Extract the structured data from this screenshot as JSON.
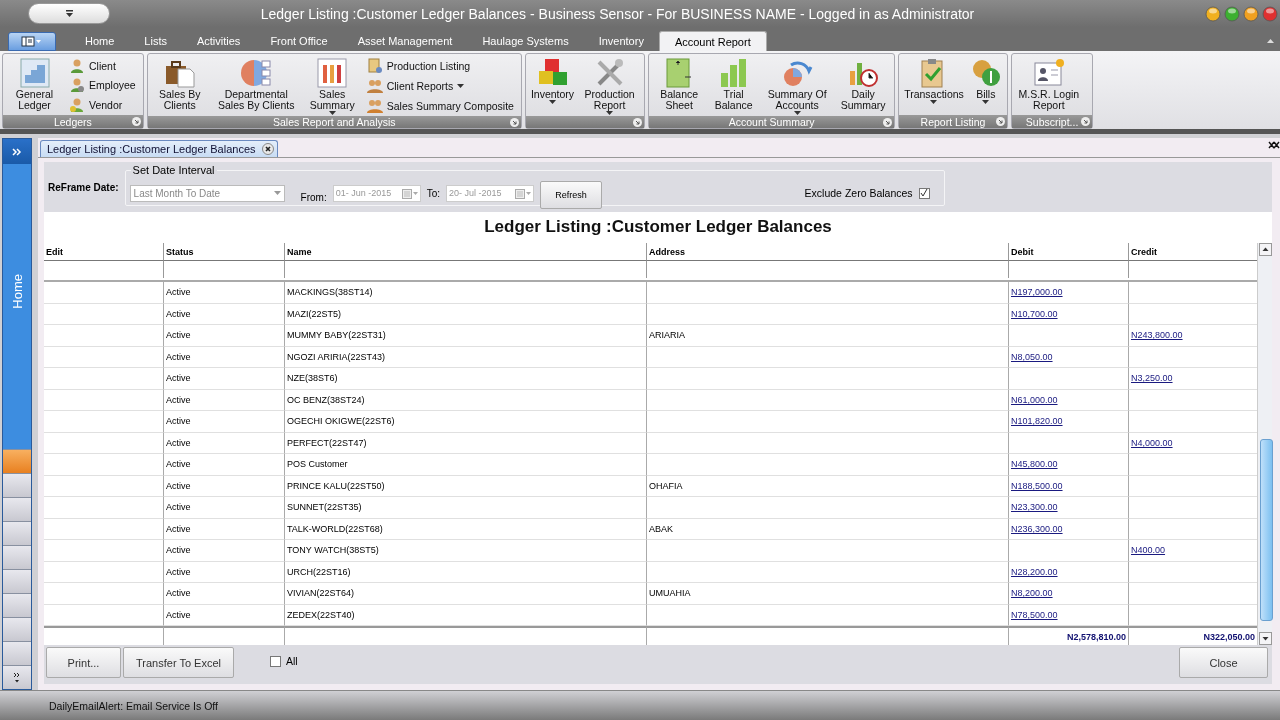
{
  "window": {
    "title": "Ledger Listing :Customer Ledger Balances - Business Sensor - For BUSINESS NAME - Logged in as Administrator"
  },
  "ribbon_tabs": [
    {
      "label": "Home",
      "selected": false
    },
    {
      "label": "Lists",
      "selected": false
    },
    {
      "label": "Activities",
      "selected": false
    },
    {
      "label": "Front Office",
      "selected": false
    },
    {
      "label": "Asset Management",
      "selected": false
    },
    {
      "label": "Haulage Systems",
      "selected": false
    },
    {
      "label": "Inventory",
      "selected": false
    },
    {
      "label": "Account Report",
      "selected": true
    }
  ],
  "ribbon_groups": [
    {
      "label": "Ledgers",
      "items": [
        {
          "kind": "large",
          "label": "General Ledger",
          "dropdown": false
        },
        {
          "kind": "small",
          "label": "Client",
          "dropdown": false
        },
        {
          "kind": "small",
          "label": "Employee",
          "dropdown": false
        },
        {
          "kind": "small",
          "label": "Vendor",
          "dropdown": false
        }
      ]
    },
    {
      "label": "Sales Report and Analysis",
      "items": [
        {
          "kind": "large",
          "label": "Sales By Clients",
          "dropdown": false
        },
        {
          "kind": "large",
          "label": "Departmental Sales By Clients",
          "dropdown": false
        },
        {
          "kind": "large",
          "label": "Sales Summary",
          "dropdown": true
        },
        {
          "kind": "small",
          "label": "Production Listing",
          "dropdown": false
        },
        {
          "kind": "small",
          "label": "Client Reports",
          "dropdown": true
        },
        {
          "kind": "small",
          "label": "Sales Summary Composite",
          "dropdown": false
        }
      ]
    },
    {
      "items": [
        {
          "kind": "large",
          "label": "Inventory",
          "dropdown": true
        },
        {
          "kind": "large",
          "label": "Production Report",
          "dropdown": true
        }
      ]
    },
    {
      "label": "Account Summary",
      "items": [
        {
          "kind": "large",
          "label": "Balance Sheet",
          "dropdown": false
        },
        {
          "kind": "large",
          "label": "Trial Balance",
          "dropdown": false
        },
        {
          "kind": "large",
          "label": "Summary Of Accounts",
          "dropdown": true
        },
        {
          "kind": "large",
          "label": "Daily Summary",
          "dropdown": false
        }
      ]
    },
    {
      "label": "Report Listing",
      "items": [
        {
          "kind": "large",
          "label": "Transactions",
          "dropdown": true
        },
        {
          "kind": "large",
          "label": "Bills",
          "dropdown": true
        }
      ]
    },
    {
      "label": "Subscript...",
      "items": [
        {
          "kind": "large",
          "label": "M.S.R. Login Report",
          "dropdown": false
        }
      ]
    }
  ],
  "nav": {
    "label": "Home",
    "buttons": [
      {
        "selected": true
      },
      {
        "selected": false
      },
      {
        "selected": false
      },
      {
        "selected": false
      },
      {
        "selected": false
      },
      {
        "selected": false
      },
      {
        "selected": false
      },
      {
        "selected": false
      },
      {
        "selected": false
      }
    ]
  },
  "document_tab": {
    "label": "Ledger Listing :Customer Ledger Balances"
  },
  "filter": {
    "reframe_label": "ReFrame Date:",
    "group_title": "Set Date Interval",
    "period": "Last Month To Date",
    "from_label": "From:",
    "from": "01- Jun -2015",
    "to_label": "To:",
    "to": "20- Jul -2015",
    "refresh": "Refresh",
    "exclude_zero_label": "Exclude Zero Balances",
    "exclude_zero_checked": true
  },
  "report_title": "Ledger Listing :Customer Ledger Balances",
  "table": {
    "columns": [
      "Edit",
      "Status",
      "Name",
      "Address",
      "Debit",
      "Credit"
    ],
    "rows": [
      {
        "status": "Active",
        "name": "MACKINGS(38ST14)",
        "debit": "N197,000.00"
      },
      {
        "status": "Active",
        "name": "MAZI(22ST5)",
        "debit": "N10,700.00"
      },
      {
        "status": "Active",
        "name": "MUMMY BABY(22ST31)",
        "address": "ARIARIA",
        "credit": "N243,800.00"
      },
      {
        "status": "Active",
        "name": "NGOZI ARIRIA(22ST43)",
        "debit": "N8,050.00"
      },
      {
        "status": "Active",
        "name": "NZE(38ST6)",
        "credit": "N3,250.00"
      },
      {
        "status": "Active",
        "name": "OC BENZ(38ST24)",
        "debit": "N61,000.00"
      },
      {
        "status": "Active",
        "name": "OGECHI OKIGWE(22ST6)",
        "debit": "N101,820.00"
      },
      {
        "status": "Active",
        "name": "PERFECT(22ST47)",
        "credit": "N4,000.00"
      },
      {
        "status": "Active",
        "name": "POS Customer",
        "debit": "N45,800.00"
      },
      {
        "status": "Active",
        "name": "PRINCE KALU(22ST50)",
        "address": "OHAFIA",
        "debit": "N188,500.00"
      },
      {
        "status": "Active",
        "name": "SUNNET(22ST35)",
        "debit": "N23,300.00"
      },
      {
        "status": "Active",
        "name": "TALK-WORLD(22ST68)",
        "address": "ABAK",
        "debit": "N236,300.00"
      },
      {
        "status": "Active",
        "name": "TONY WATCH(38ST5)",
        "credit": "N400.00"
      },
      {
        "status": "Active",
        "name": "URCH(22ST16)",
        "debit": "N28,200.00"
      },
      {
        "status": "Active",
        "name": "VIVIAN(22ST64)",
        "address": "UMUAHIA",
        "debit": "N8,200.00"
      },
      {
        "status": "Active",
        "name": "ZEDEX(22ST40)",
        "debit": "N78,500.00"
      }
    ],
    "totals": {
      "debit": "N2,578,810.00",
      "credit": "N322,050.00"
    }
  },
  "footer": {
    "print": "Print...",
    "excel": "Transfer To Excel",
    "all_label": "All",
    "all_checked": false,
    "close": "Close"
  },
  "status_bar": "DailyEmailAlert: Email Service Is Off"
}
